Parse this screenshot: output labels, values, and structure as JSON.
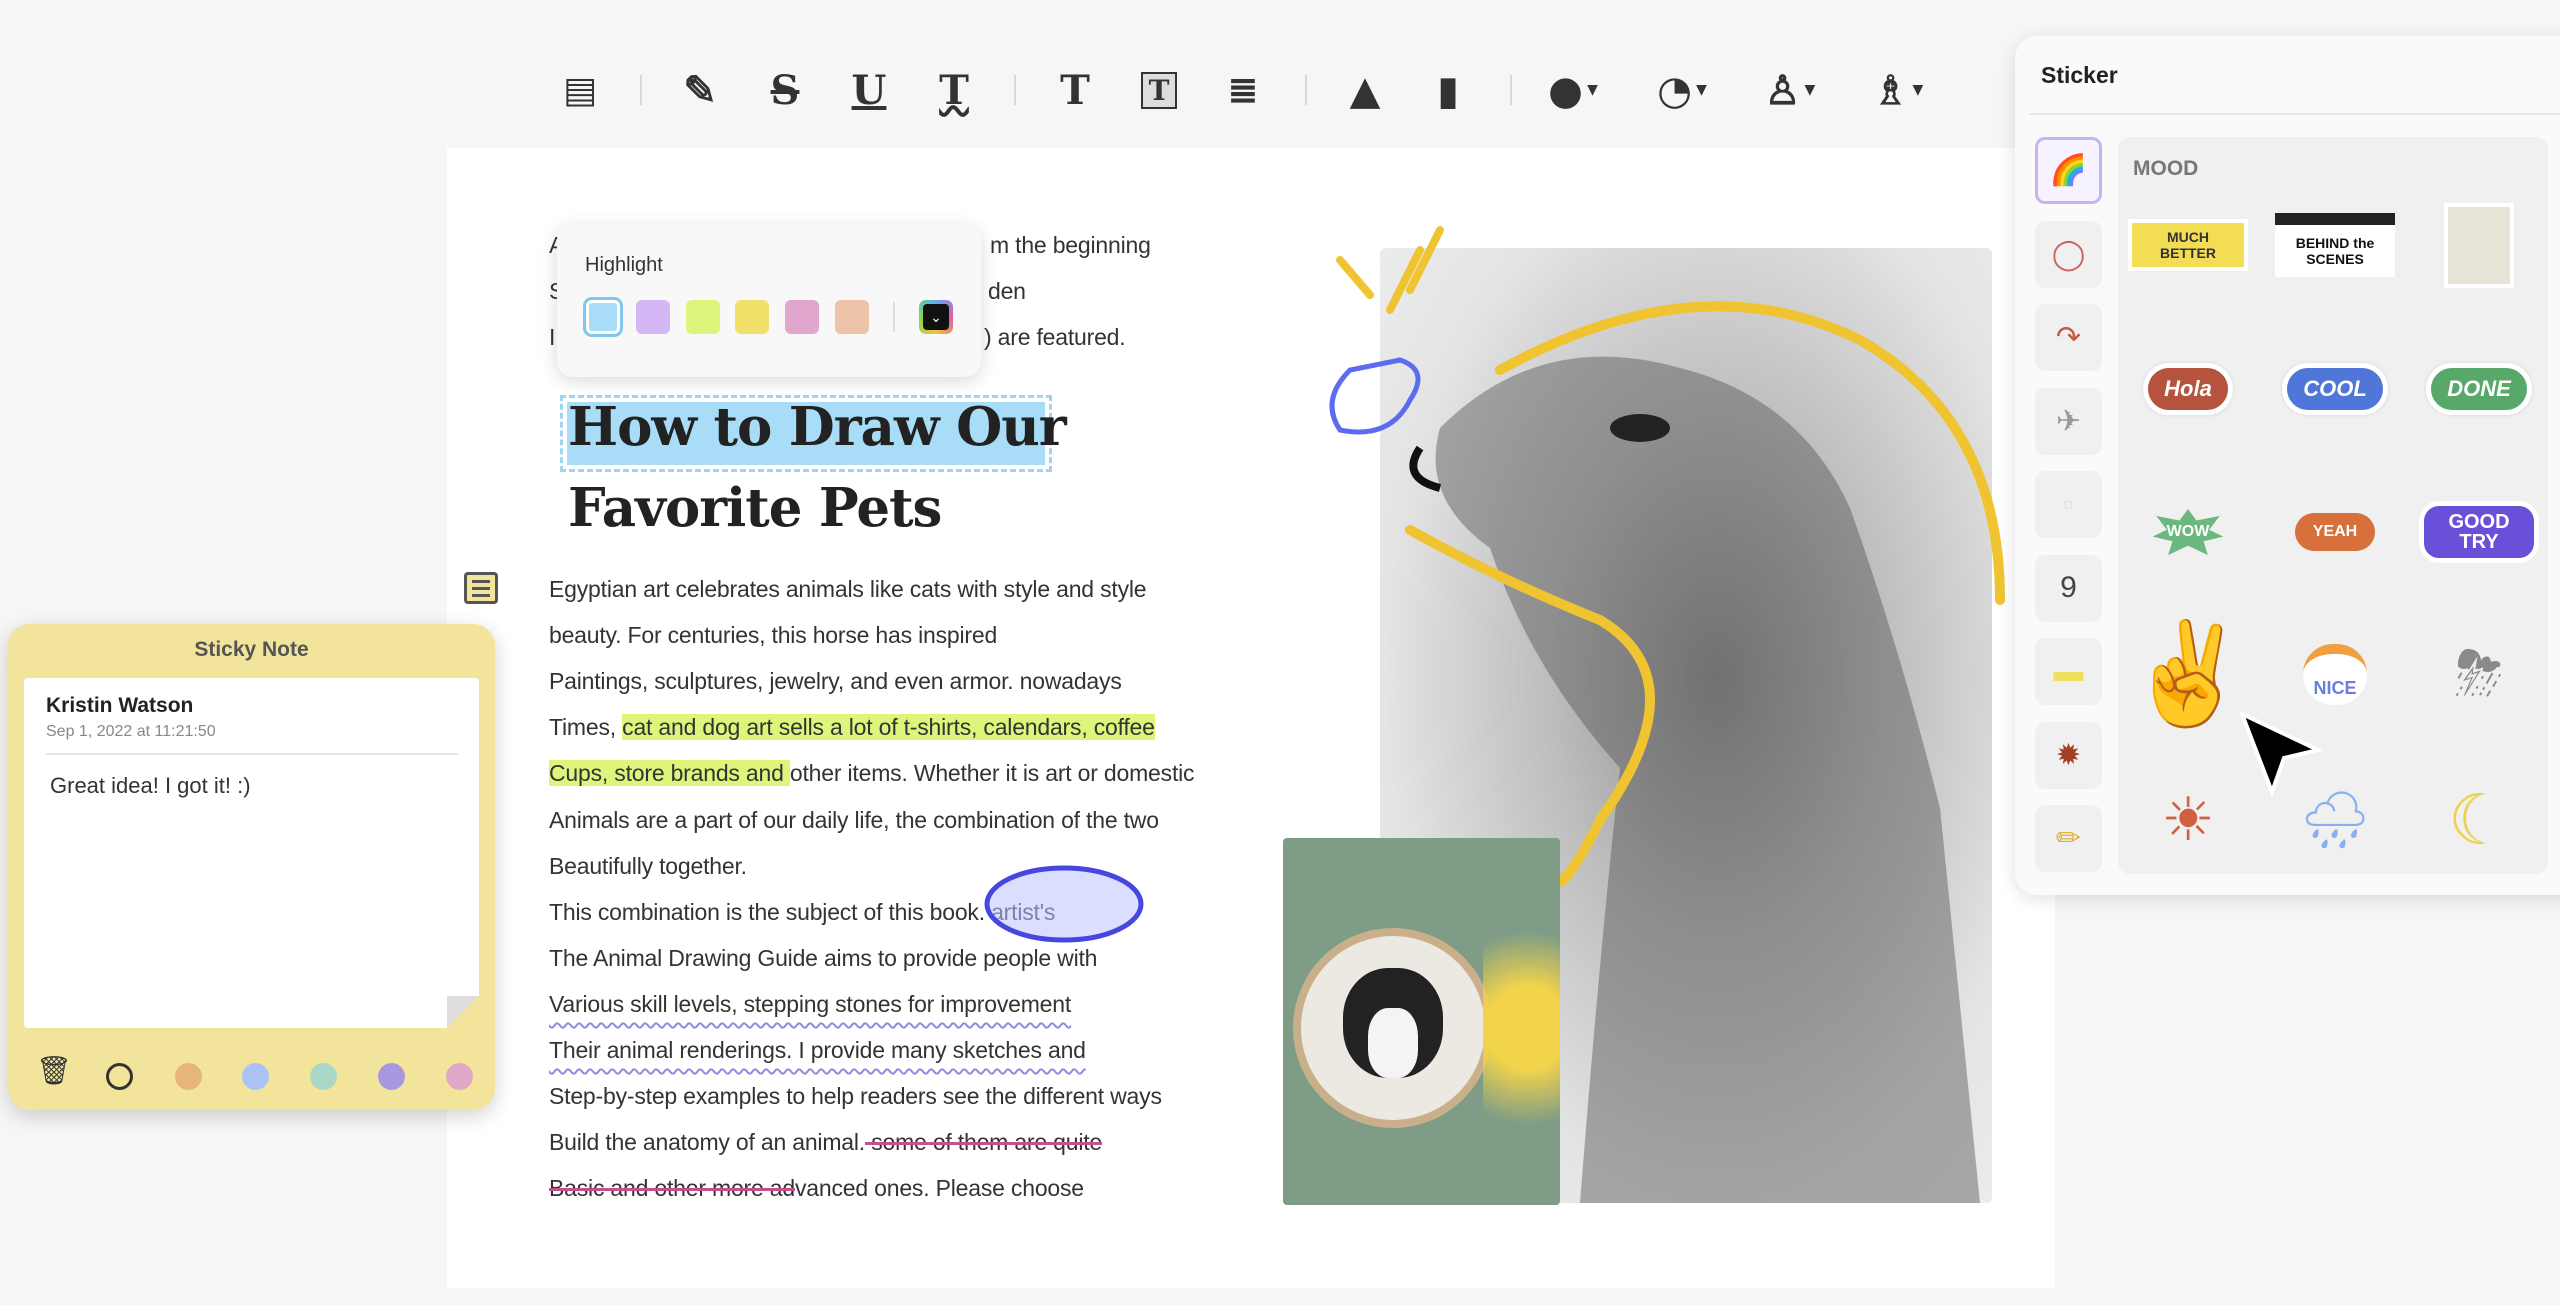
{
  "toolbar": {
    "items": [
      {
        "icon": "comment-icon",
        "glyph": "▤"
      },
      {
        "icon": "highlighter-icon",
        "glyph": "✎"
      },
      {
        "icon": "strikethrough-icon",
        "glyph": "S"
      },
      {
        "icon": "underline-icon",
        "glyph": "U"
      },
      {
        "icon": "squiggly-underline-icon",
        "glyph": "T"
      },
      {
        "icon": "text-icon",
        "glyph": "T"
      },
      {
        "icon": "text-box-icon",
        "glyph": "T"
      },
      {
        "icon": "text-callout-icon",
        "glyph": "≣"
      },
      {
        "icon": "pencil-icon",
        "glyph": "▲"
      },
      {
        "icon": "eraser-icon",
        "glyph": "▮"
      },
      {
        "icon": "shape-icon",
        "glyph": "●"
      },
      {
        "icon": "area-highlight-icon",
        "glyph": "◔"
      },
      {
        "icon": "stamp-icon",
        "glyph": "♙"
      },
      {
        "icon": "signature-pen-icon",
        "glyph": "♗"
      }
    ]
  },
  "highlight_popup": {
    "title": "Highlight",
    "colors": [
      "#a8dcf7",
      "#d4b8f6",
      "#def57c",
      "#f3e06a",
      "#e0a6cb",
      "#ecc2a8"
    ],
    "selected": 0
  },
  "document": {
    "partial_lines": [
      {
        "left": "A",
        "right": "m the beginning"
      },
      {
        "left": "S",
        "right": "den"
      },
      {
        "left": "I",
        "right": ") are featured."
      }
    ],
    "title_line1": "How to Draw Our",
    "title_line2": "Favorite Pets",
    "highlight_color": "#a8dcf7",
    "body": [
      [
        {
          "t": "Egyptian art celebrates animals like cats with style and style",
          "s": ""
        }
      ],
      [
        {
          "t": "beauty. For centuries, this horse has inspired",
          "s": ""
        }
      ],
      [
        {
          "t": "Paintings, sculptures, jewelry, and even armor. nowadays",
          "s": ""
        }
      ],
      [
        {
          "t": "Times, ",
          "s": ""
        },
        {
          "t": "cat and dog art sells a lot of t-shirts, calendars, coffee",
          "s": "hl"
        }
      ],
      [
        {
          "t": "Cups, store brands and ",
          "s": "hl"
        },
        {
          "t": "other items. Whether it is art or domestic",
          "s": ""
        }
      ],
      [
        {
          "t": "Animals are a part of our daily life, the combination of the two",
          "s": ""
        }
      ],
      [
        {
          "t": "Beautifully together.",
          "s": ""
        }
      ],
      [
        {
          "t": "This combination is the subject of this book. artist's",
          "s": ""
        }
      ],
      [
        {
          "t": "The Animal Drawing Guide aims to provide people with",
          "s": ""
        }
      ],
      [
        {
          "t": "Various skill levels, stepping stones for improvement",
          "s": "wavy"
        }
      ],
      [
        {
          "t": "Their animal renderings. I provide many sketches and",
          "s": "wavy"
        }
      ],
      [
        {
          "t": "Step-by-step examples to help readers see the different ways",
          "s": ""
        }
      ],
      [
        {
          "t": "Build the anatomy of an animal.",
          "s": ""
        },
        {
          "t": " some of them are quite ",
          "s": "strike"
        }
      ],
      [
        {
          "t": "Basic and other more ad",
          "s": "strike"
        },
        {
          "t": "vanced ones. Please choose",
          "s": ""
        }
      ]
    ]
  },
  "sticky_note": {
    "title": "Sticky Note",
    "author": "Kristin Watson",
    "timestamp": "Sep 1, 2022 at 11:21:50",
    "content": "Great idea! I got it! :)",
    "colors": [
      "#e6b57a",
      "#aac2f5",
      "#a9d9c6",
      "#a898e0",
      "#e0a8c8"
    ]
  },
  "sticker_panel": {
    "title": "Sticker",
    "category": "MOOD",
    "tabs": [
      "rainbow",
      "circle",
      "arrow",
      "paper-plane",
      "note-paper",
      "number-nine",
      "tape",
      "burst",
      "pencil"
    ],
    "stickers": [
      {
        "name": "much-better",
        "text": "MUCH BETTER"
      },
      {
        "name": "behind-the-scenes",
        "text": "BEHIND the SCENES"
      },
      {
        "name": "notepad",
        "text": ""
      },
      {
        "name": "hola",
        "text": "Hola"
      },
      {
        "name": "cool",
        "text": "COOL"
      },
      {
        "name": "done",
        "text": "DONE"
      },
      {
        "name": "wow",
        "text": "WOW"
      },
      {
        "name": "yeah",
        "text": "YEAH"
      },
      {
        "name": "good-try",
        "text": "GOOD TRY"
      },
      {
        "name": "peace-hand",
        "text": "✌"
      },
      {
        "name": "nice",
        "text": "NICE"
      },
      {
        "name": "storm-cloud",
        "text": "⛈"
      },
      {
        "name": "sun",
        "text": "☀"
      },
      {
        "name": "rain-cloud",
        "text": "🌧"
      },
      {
        "name": "moon",
        "text": "☾"
      }
    ]
  }
}
